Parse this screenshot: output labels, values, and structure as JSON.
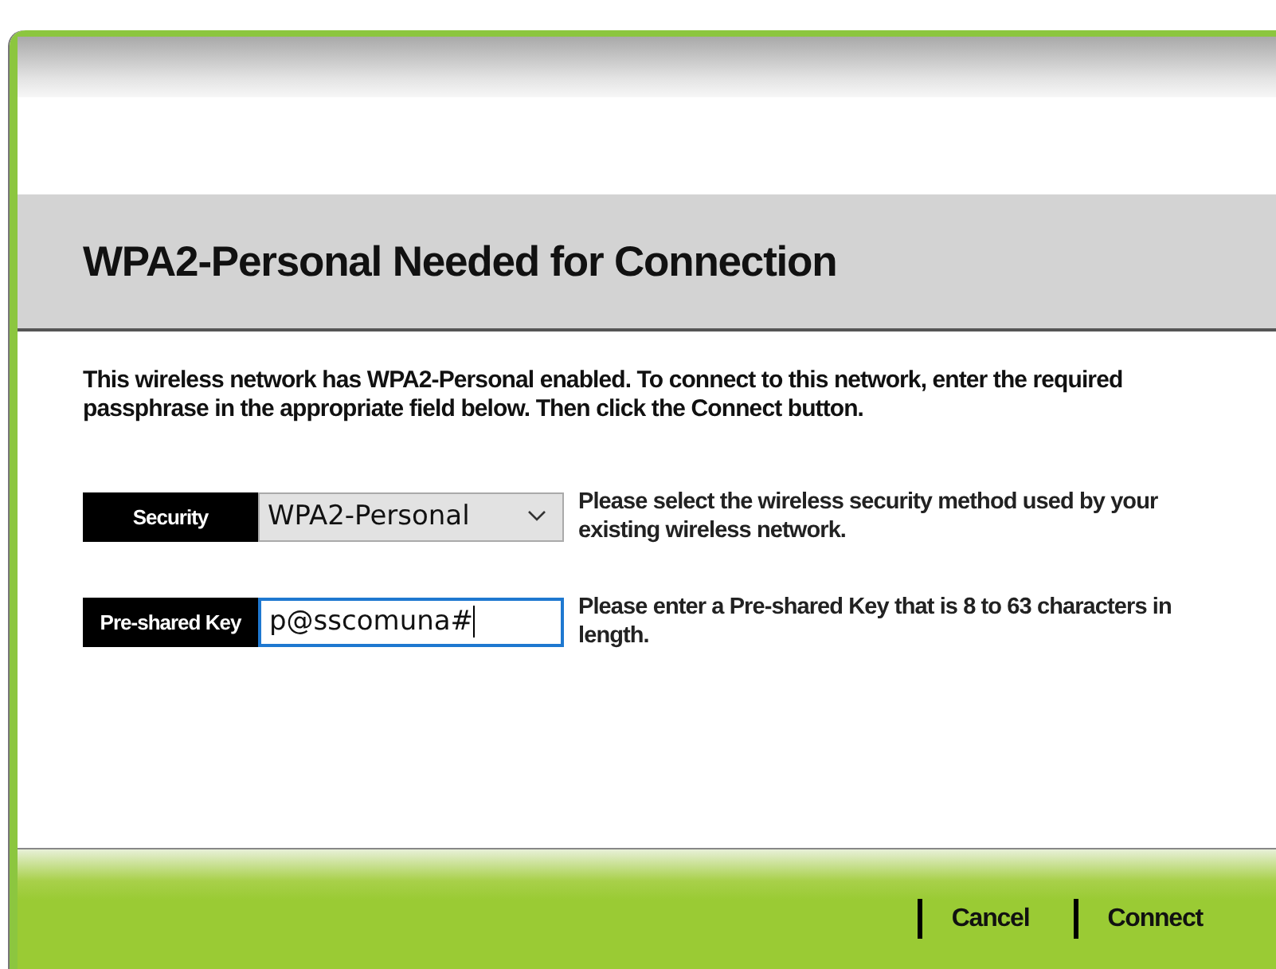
{
  "title": "WPA2-Personal Needed for Connection",
  "description": "This wireless network has WPA2-Personal enabled. To connect to this network, enter the required passphrase in the appropriate field below. Then click the **Connect** button.",
  "fields": [
    {
      "kind": "select",
      "label": "Security",
      "value": "WPA2-Personal",
      "help": "Please select the wireless security method used by your existing wireless network.",
      "focused": false
    },
    {
      "kind": "input",
      "label": "Pre-shared Key",
      "value": "p@sscomuna#",
      "help": "Please enter a Pre-shared Key that is 8 to 63 characters in length.",
      "focused": true
    }
  ],
  "buttons": [
    "Cancel",
    "Connect"
  ]
}
